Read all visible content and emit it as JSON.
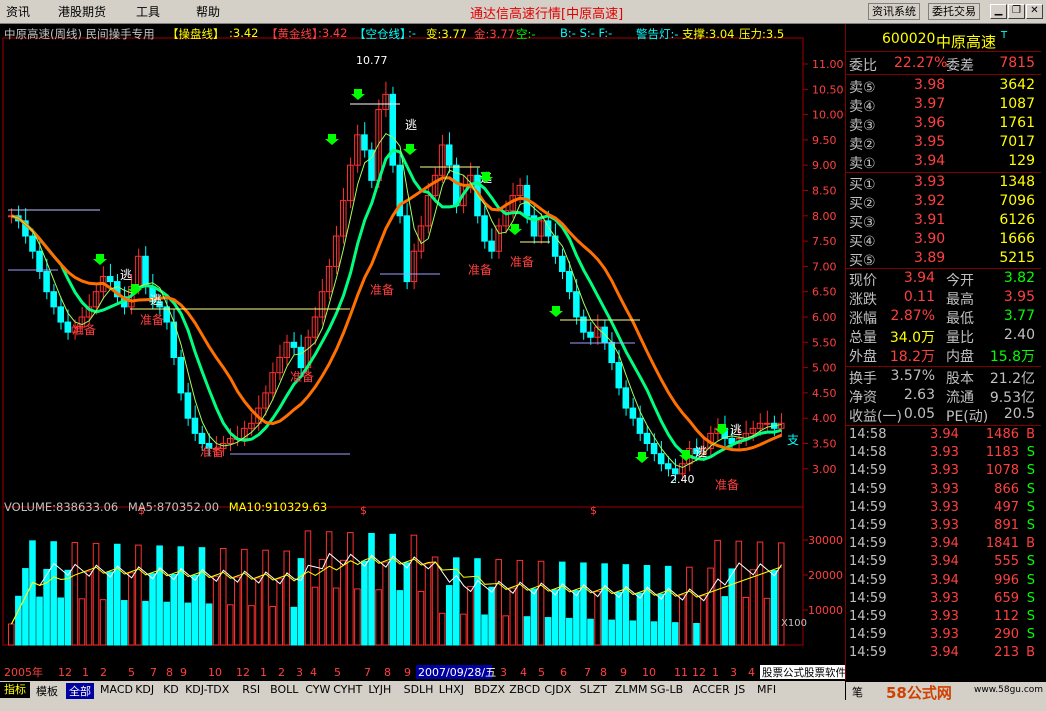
{
  "menu": [
    "资讯",
    "港股期货",
    "工具",
    "帮助"
  ],
  "window_title": "通达信高速行情[中原高速]",
  "toolbar": {
    "info_system": "资讯系统",
    "delegate_trade": "委托交易"
  },
  "chart_info": {
    "title": "中原高速(周线) 民间操手专用",
    "cpx_label": "【操盘线】",
    "cpx_value": ":3.42",
    "hjx_label": "【黄金线】",
    "hjx_value": ":3.42",
    "kcx_label": "【空仓线】",
    "kcx_value": ":-",
    "bian": "变:3.77",
    "jin": "金:3.77",
    "kong": "空:-",
    "bsf": "B:- S:- F:-",
    "alert": "警告灯:-",
    "support": "支撑:3.04",
    "pressure": "压力:3.5"
  },
  "volume_info": {
    "volume": "VOLUME:838633.06",
    "ma5": "MA5:870352.00",
    "ma10": "MA10:910329.63"
  },
  "price_axis": [
    "11.00",
    "10.50",
    "10.00",
    "9.50",
    "9.00",
    "8.50",
    "8.00",
    "7.50",
    "7.00",
    "6.50",
    "6.00",
    "5.50",
    "5.00",
    "4.50",
    "4.00",
    "3.50",
    "3.00"
  ],
  "volume_axis": [
    "30000",
    "20000",
    "10000"
  ],
  "volume_unit": "X100",
  "annotations": {
    "high": "10.77",
    "low": "2.40",
    "escape": "逃",
    "prepare": "准备",
    "buy": "买",
    "support_short": "支"
  },
  "time_axis": {
    "labels": [
      "2005年",
      "12",
      "1",
      "2",
      "5",
      "7",
      "8",
      "9",
      "10",
      "12",
      "1",
      "2",
      "3",
      "4",
      "5",
      "7",
      "8",
      "9",
      "3",
      "4",
      "5",
      "6",
      "7",
      "8",
      "9",
      "10",
      "11",
      "12",
      "1",
      "3",
      "4"
    ],
    "highlight": "2007/09/28/五"
  },
  "quote": {
    "code": "600020",
    "name": "中原高速",
    "weibi_label": "委比",
    "weibi": "22.27%",
    "weicha_label": "委差",
    "weicha": "7815",
    "sells": [
      {
        "label": "卖⑤",
        "price": "3.98",
        "vol": "3642"
      },
      {
        "label": "卖④",
        "price": "3.97",
        "vol": "1087"
      },
      {
        "label": "卖③",
        "price": "3.96",
        "vol": "1761"
      },
      {
        "label": "卖②",
        "price": "3.95",
        "vol": "7017"
      },
      {
        "label": "卖①",
        "price": "3.94",
        "vol": "129"
      }
    ],
    "buys": [
      {
        "label": "买①",
        "price": "3.93",
        "vol": "1348"
      },
      {
        "label": "买②",
        "price": "3.92",
        "vol": "7096"
      },
      {
        "label": "买③",
        "price": "3.91",
        "vol": "6126"
      },
      {
        "label": "买④",
        "price": "3.90",
        "vol": "1666"
      },
      {
        "label": "买⑤",
        "price": "3.89",
        "vol": "5215"
      }
    ],
    "stats": [
      {
        "l1": "现价",
        "v1": "3.94",
        "l2": "今开",
        "v2": "3.82"
      },
      {
        "l1": "涨跌",
        "v1": "0.11",
        "l2": "最高",
        "v2": "3.95"
      },
      {
        "l1": "涨幅",
        "v1": "2.87%",
        "l2": "最低",
        "v2": "3.77"
      },
      {
        "l1": "总量",
        "v1": "34.0万",
        "l2": "量比",
        "v2": "2.40"
      },
      {
        "l1": "外盘",
        "v1": "18.2万",
        "l2": "内盘",
        "v2": "15.8万"
      }
    ],
    "fin": [
      {
        "l1": "换手",
        "v1": "3.57%",
        "l2": "股本",
        "v2": "21.2亿"
      },
      {
        "l1": "净资",
        "v1": "2.63",
        "l2": "流通",
        "v2": "9.53亿"
      },
      {
        "l1": "收益(一)",
        "v1": "0.05",
        "l2": "PE(动)",
        "v2": "20.5"
      }
    ],
    "ticks": [
      {
        "t": "14:58",
        "p": "3.94",
        "v": "1486",
        "d": "B"
      },
      {
        "t": "14:58",
        "p": "3.93",
        "v": "1183",
        "d": "S"
      },
      {
        "t": "14:59",
        "p": "3.93",
        "v": "1078",
        "d": "S"
      },
      {
        "t": "14:59",
        "p": "3.93",
        "v": "866",
        "d": "S"
      },
      {
        "t": "14:59",
        "p": "3.93",
        "v": "497",
        "d": "S"
      },
      {
        "t": "14:59",
        "p": "3.93",
        "v": "891",
        "d": "S"
      },
      {
        "t": "14:59",
        "p": "3.94",
        "v": "1841",
        "d": "B"
      },
      {
        "t": "14:59",
        "p": "3.94",
        "v": "555",
        "d": "S"
      },
      {
        "t": "14:59",
        "p": "3.94",
        "v": "996",
        "d": "S"
      },
      {
        "t": "14:59",
        "p": "3.93",
        "v": "659",
        "d": "S"
      },
      {
        "t": "14:59",
        "p": "3.93",
        "v": "112",
        "d": "S"
      },
      {
        "t": "14:59",
        "p": "3.93",
        "v": "290",
        "d": "S"
      },
      {
        "t": "14:59",
        "p": "3.94",
        "v": "213",
        "d": "B"
      }
    ]
  },
  "tabs": [
    "指标",
    "模板",
    "全部"
  ],
  "indicators": [
    "MACD",
    "KDJ",
    "KD",
    "KDJ-TDX",
    "RSI",
    "BOLL",
    "CYW",
    "CYHT",
    "LYJH",
    "SDLH",
    "LHXJ",
    "BDZX",
    "ZBCD",
    "CJDX",
    "SLZT",
    "ZLMM",
    "SG-LB",
    "ACCER",
    "JS",
    "MFI"
  ],
  "ticker_text": "股票公式股票软件下载|分析家公式网",
  "watermark": "58公式网",
  "watermark_url": "www.58gu.com",
  "bottom_left": "笔"
}
